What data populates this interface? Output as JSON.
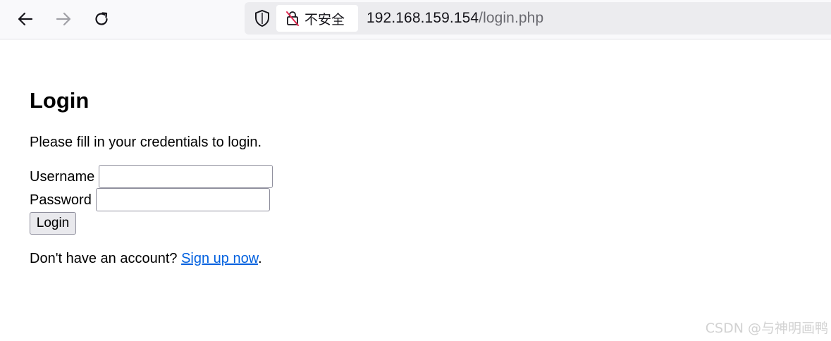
{
  "browser": {
    "security_label": "不安全",
    "url_host": "192.168.159.154",
    "url_path": "/login.php",
    "icons": {
      "back": "arrow-left-icon",
      "forward": "arrow-right-icon",
      "reload": "reload-icon",
      "shield": "shield-icon",
      "insecure_lock": "insecure-lock-icon"
    }
  },
  "page": {
    "title": "Login",
    "intro": "Please fill in your credentials to login.",
    "username_label": "Username",
    "username_value": "",
    "password_label": "Password",
    "password_value": "",
    "login_button": "Login",
    "signup_prefix": "Don't have an account? ",
    "signup_link": "Sign up now",
    "signup_suffix": ".",
    "link_color": "#0060df"
  },
  "watermark": "CSDN @与神明画鸭"
}
